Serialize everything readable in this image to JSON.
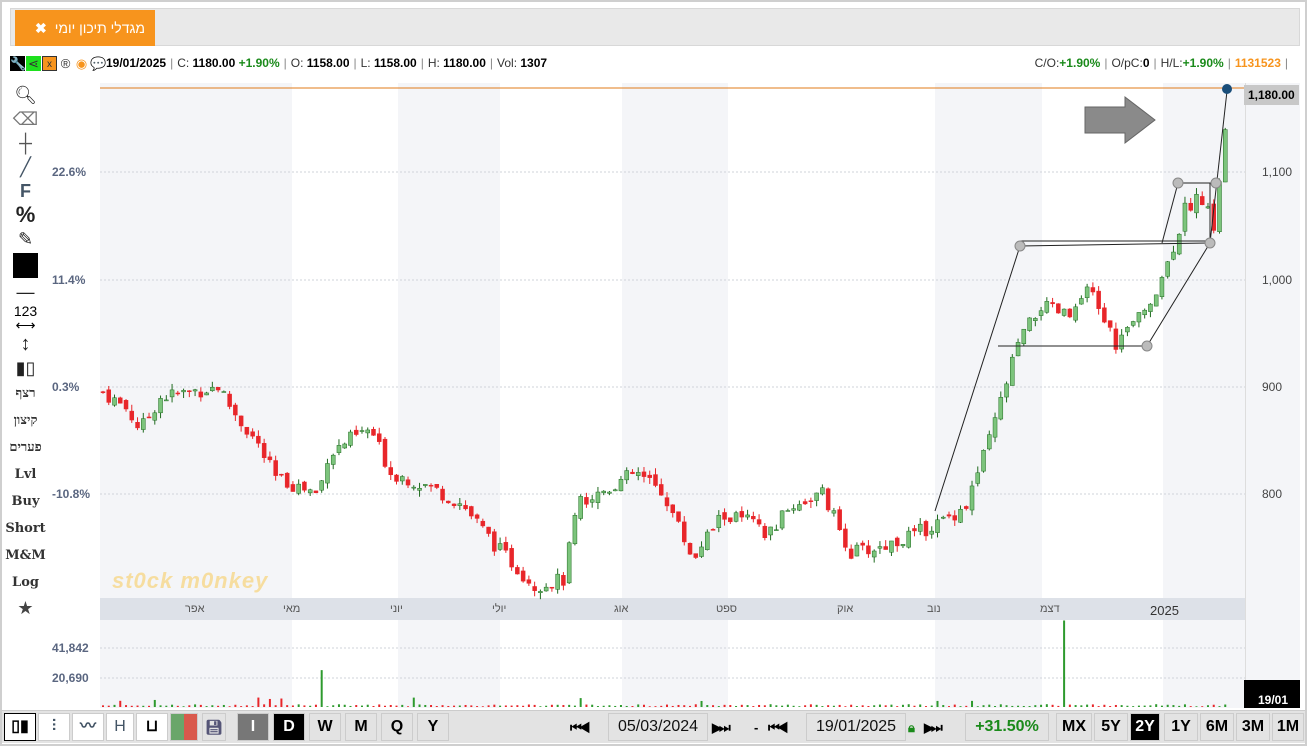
{
  "tab": {
    "title": "מגדלי תיכון יומי",
    "close": "✖"
  },
  "info": {
    "date": "19/01/2025",
    "c_label": "C:",
    "close": "1180.00",
    "change": "+1.90%",
    "o_label": "O:",
    "open": "1158.00",
    "l_label": "L:",
    "low": "1158.00",
    "h_label": "H:",
    "high": "1180.00",
    "vol_label": "Vol:",
    "vol": "1307",
    "co_label": "C/O:",
    "co": "+1.90%",
    "opc_label": "O/pC:",
    "opc": "0",
    "hl_label": "H/L:",
    "hl": "+1.90%",
    "id": "1131523"
  },
  "left_tools": [
    "רצף",
    "קיצון",
    "פערים",
    "Lvl",
    "Buy",
    "Short",
    "M&M",
    "Log"
  ],
  "pct_labels": [
    "22.6%",
    "11.4%",
    "0.3%",
    "-10.8%"
  ],
  "price_labels": [
    "1,100",
    "1,000",
    "900",
    "800"
  ],
  "last_price": "1,180.00",
  "last_date": "19/01",
  "volume_labels": [
    "41,842",
    "20,690"
  ],
  "months": [
    "אפר",
    "מאי",
    "יוני",
    "יולי",
    "אוג",
    "ספט",
    "אוק",
    "נוב",
    "דצמ",
    "2025"
  ],
  "watermark": "st0ck m0nkey",
  "bottom": {
    "periods": [
      "I",
      "D",
      "W",
      "M",
      "Q",
      "Y"
    ],
    "start_date": "05/03/2024",
    "dash": "-",
    "end_date": "19/01/2025",
    "range_change": "+31.50%",
    "ranges": [
      "MX",
      "5Y",
      "2Y",
      "1Y",
      "6M",
      "3M",
      "1M"
    ],
    "chart_type_h": "H"
  },
  "chart_data": {
    "type": "candlestick",
    "ylim": [
      700,
      1190
    ],
    "price_path": [
      [
        0,
        895
      ],
      [
        8,
        880
      ],
      [
        13,
        860
      ],
      [
        20,
        890
      ],
      [
        30,
        895
      ],
      [
        40,
        900
      ],
      [
        47,
        870
      ],
      [
        53,
        850
      ],
      [
        60,
        815
      ],
      [
        70,
        805
      ],
      [
        75,
        800
      ],
      [
        78,
        835
      ],
      [
        85,
        850
      ],
      [
        93,
        860
      ],
      [
        100,
        820
      ],
      [
        115,
        805
      ],
      [
        125,
        790
      ],
      [
        137,
        750
      ],
      [
        150,
        715
      ],
      [
        160,
        720
      ],
      [
        165,
        790
      ],
      [
        175,
        805
      ],
      [
        185,
        820
      ],
      [
        195,
        800
      ],
      [
        205,
        740
      ],
      [
        215,
        780
      ],
      [
        225,
        775
      ],
      [
        230,
        760
      ],
      [
        240,
        790
      ],
      [
        250,
        800
      ],
      [
        260,
        745
      ],
      [
        270,
        750
      ],
      [
        280,
        760
      ],
      [
        292,
        775
      ],
      [
        300,
        790
      ],
      [
        308,
        850
      ],
      [
        318,
        940
      ],
      [
        326,
        975
      ],
      [
        336,
        965
      ],
      [
        343,
        990
      ],
      [
        352,
        940
      ],
      [
        362,
        970
      ],
      [
        370,
        1015
      ],
      [
        376,
        1065
      ],
      [
        381,
        1080
      ],
      [
        386,
        1050
      ],
      [
        392,
        1180
      ]
    ],
    "candles": 392,
    "volume_spikes": [
      [
        76,
        26000
      ],
      [
        334,
        61000
      ]
    ]
  }
}
